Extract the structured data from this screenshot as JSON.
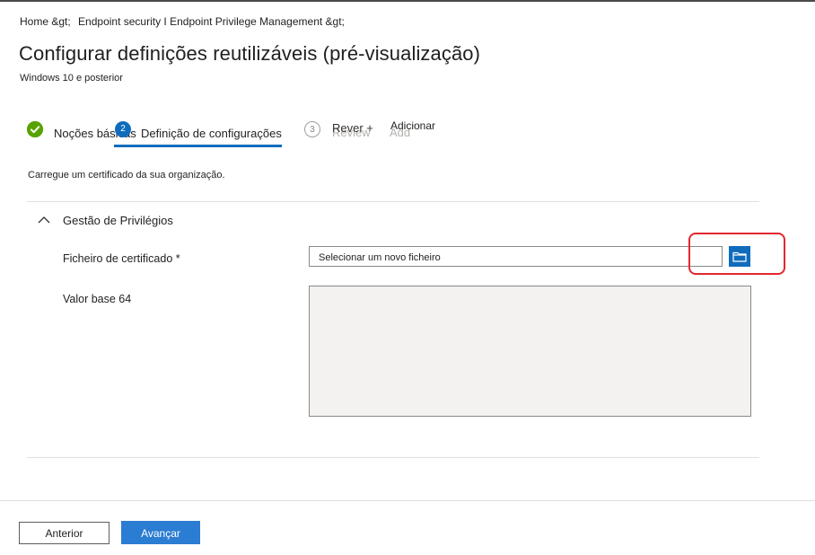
{
  "breadcrumb": {
    "items": [
      "Home &gt;",
      "Endpoint security I Endpoint Privilege Management &gt;"
    ]
  },
  "header": {
    "title": "Configurar definições reutilizáveis (pré-visualização)",
    "subtitle": "Windows 10 e posterior"
  },
  "wizard": {
    "steps": [
      {
        "number": "1",
        "label": "Noções básicas",
        "state": "completed"
      },
      {
        "number": "2",
        "label": "Definição de configurações",
        "state": "current"
      },
      {
        "number": "3",
        "label": "Rever +",
        "state": "upcoming"
      }
    ],
    "ghost_labels": [
      "Review",
      "Add"
    ],
    "step3_extra": "Adicionar"
  },
  "main": {
    "description": "Carregue um certificado da sua organização.",
    "section": {
      "title": "Gestão de Privilégios",
      "fields": {
        "certificate_label": "Ficheiro de certificado *",
        "certificate_placeholder": "Selecionar um novo ficheiro",
        "base64_label": "Valor base 64",
        "base64_value": ""
      }
    }
  },
  "footer": {
    "previous_label": "Anterior",
    "next_label": "Avançar"
  },
  "colors": {
    "accent": "#0f6cbd",
    "success": "#57a300",
    "highlight": "#e3262f",
    "primary_button": "#2b7cd3"
  },
  "icons": {
    "completed_step": "checkmark-icon",
    "section_toggle": "chevron-up-icon",
    "browse": "folder-icon"
  }
}
